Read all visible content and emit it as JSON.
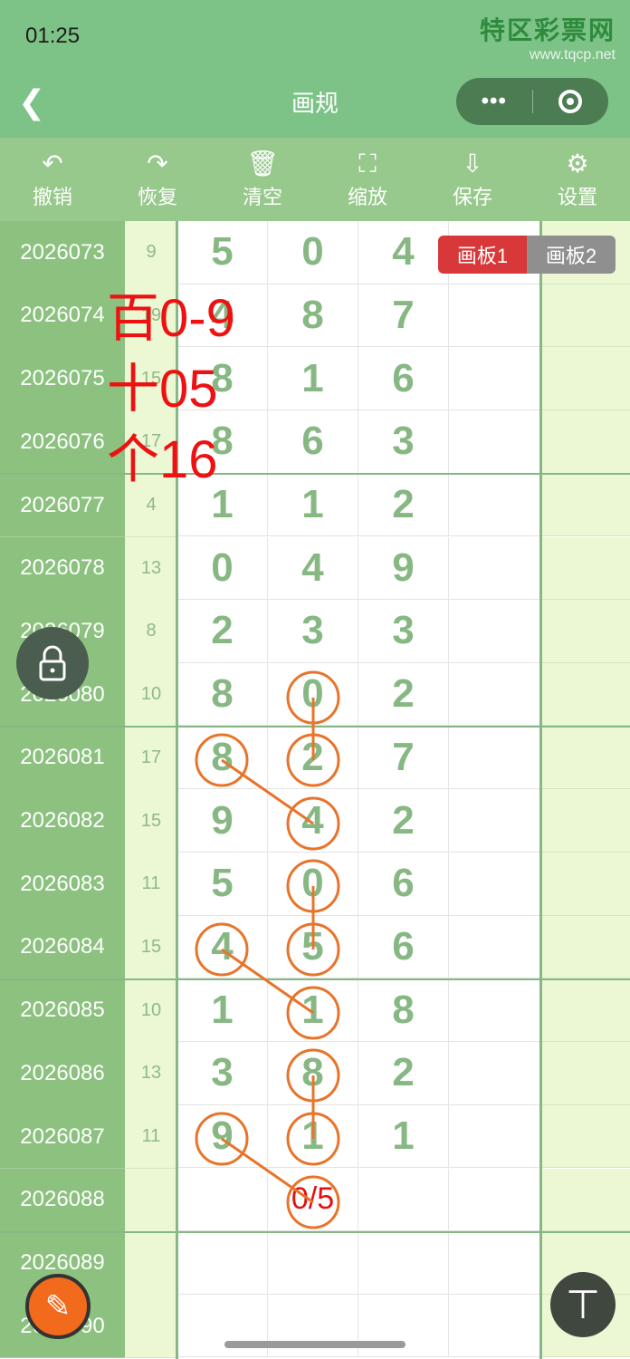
{
  "status": {
    "time": "01:25"
  },
  "watermark": {
    "title": "特区彩票网",
    "url": "www.tqcp.net"
  },
  "nav": {
    "title": "画规",
    "more": "•••"
  },
  "toolbar": [
    {
      "label": "撤销",
      "icon": "undo-icon",
      "glyph": "↶"
    },
    {
      "label": "恢复",
      "icon": "redo-icon",
      "glyph": "↷"
    },
    {
      "label": "清空",
      "icon": "trash-icon",
      "glyph": "🗑"
    },
    {
      "label": "缩放",
      "icon": "zoom-icon",
      "glyph": "⛶"
    },
    {
      "label": "保存",
      "icon": "download-icon",
      "glyph": "⇩"
    },
    {
      "label": "设置",
      "icon": "gear-icon",
      "glyph": "⚙"
    }
  ],
  "boards": {
    "b1": "画板1",
    "b2": "画板2"
  },
  "rows": [
    {
      "period": "2026073",
      "sum": "9",
      "d": [
        "5",
        "0",
        "4"
      ]
    },
    {
      "period": "2026074",
      "sum": "19",
      "d": [
        "4",
        "8",
        "7"
      ]
    },
    {
      "period": "2026075",
      "sum": "15",
      "d": [
        "8",
        "1",
        "6"
      ]
    },
    {
      "period": "2026076",
      "sum": "17",
      "d": [
        "8",
        "6",
        "3"
      ]
    },
    {
      "period": "2026077",
      "sum": "4",
      "d": [
        "1",
        "1",
        "2"
      ]
    },
    {
      "period": "2026078",
      "sum": "13",
      "d": [
        "0",
        "4",
        "9"
      ]
    },
    {
      "period": "2026079",
      "sum": "8",
      "d": [
        "2",
        "3",
        "3"
      ]
    },
    {
      "period": "2026080",
      "sum": "10",
      "d": [
        "8",
        "0",
        "2"
      ]
    },
    {
      "period": "2026081",
      "sum": "17",
      "d": [
        "8",
        "2",
        "7"
      ]
    },
    {
      "period": "2026082",
      "sum": "15",
      "d": [
        "9",
        "4",
        "2"
      ]
    },
    {
      "period": "2026083",
      "sum": "11",
      "d": [
        "5",
        "0",
        "6"
      ]
    },
    {
      "period": "2026084",
      "sum": "15",
      "d": [
        "4",
        "5",
        "6"
      ]
    },
    {
      "period": "2026085",
      "sum": "10",
      "d": [
        "1",
        "1",
        "8"
      ]
    },
    {
      "period": "2026086",
      "sum": "13",
      "d": [
        "3",
        "8",
        "2"
      ]
    },
    {
      "period": "2026087",
      "sum": "11",
      "d": [
        "9",
        "1",
        "1"
      ]
    },
    {
      "period": "2026088",
      "sum": "",
      "d": [
        "",
        "0/5",
        ""
      ]
    },
    {
      "period": "2026089",
      "sum": "",
      "d": [
        "",
        "",
        ""
      ]
    },
    {
      "period": "2026090",
      "sum": "",
      "d": [
        "",
        "",
        ""
      ]
    }
  ],
  "handwriting": [
    "百0-9",
    "十05",
    "个16"
  ],
  "colors": {
    "accent": "#7dc287",
    "mark": "#e8742a",
    "ink": "#e11111"
  }
}
